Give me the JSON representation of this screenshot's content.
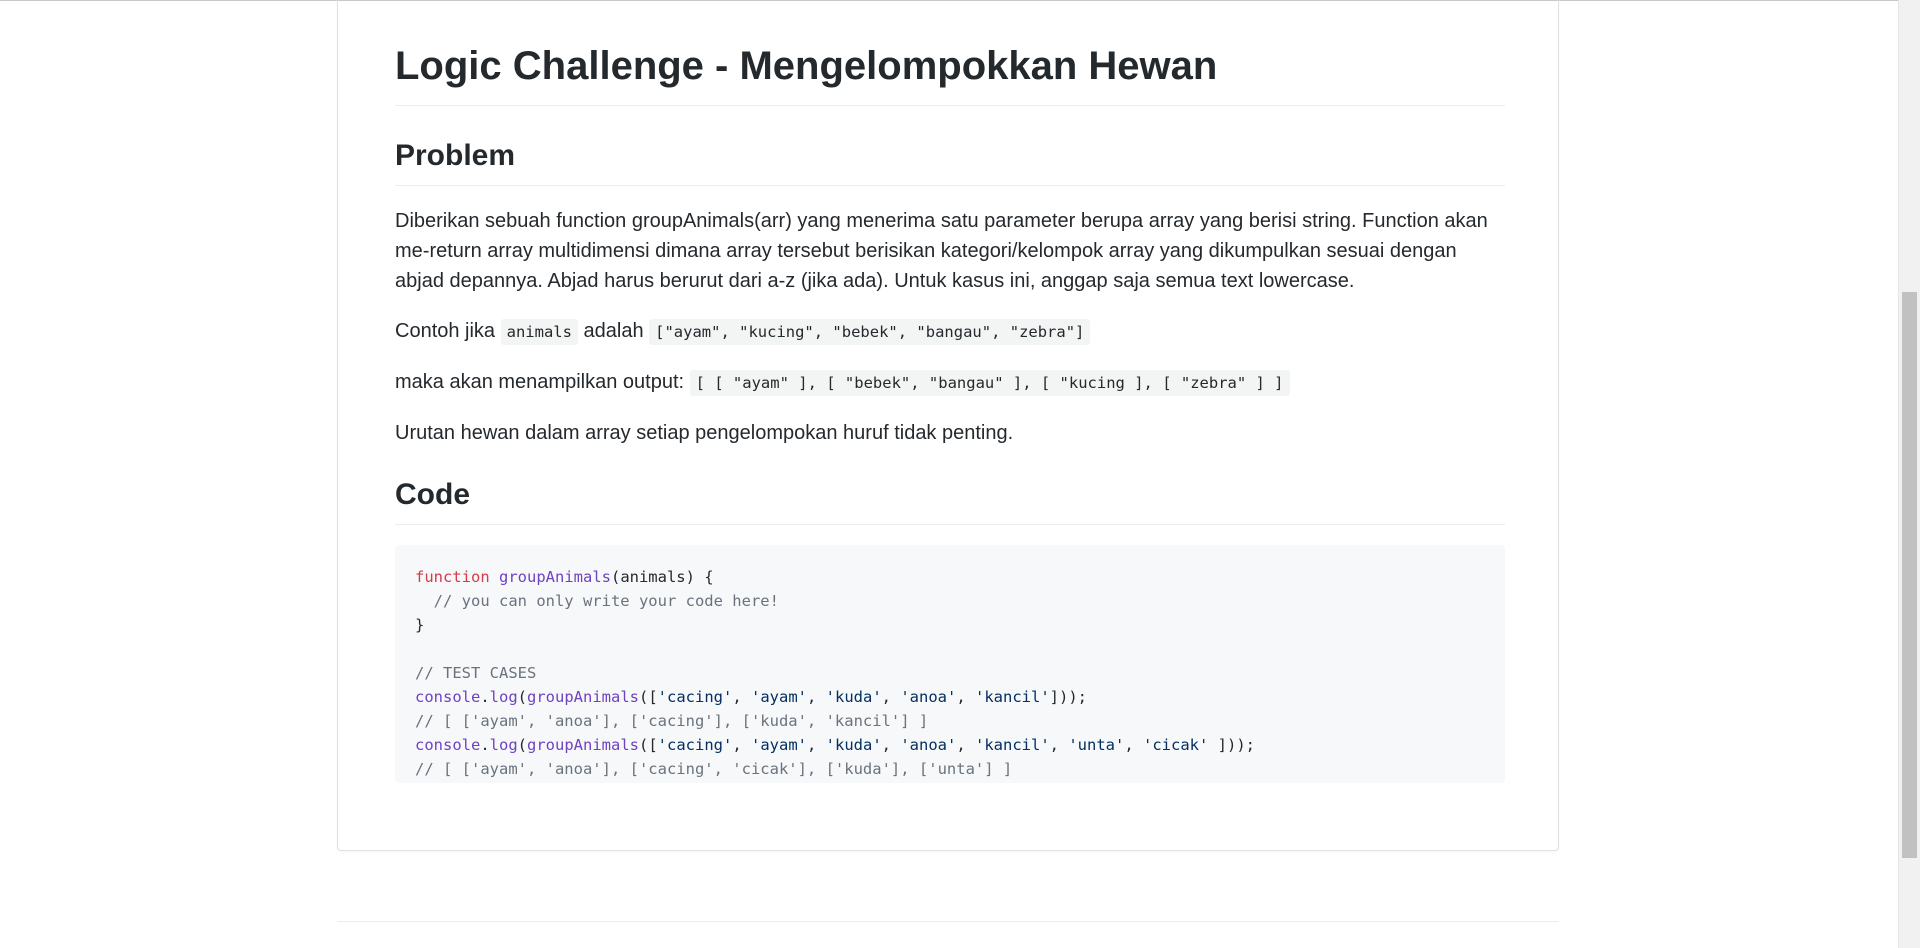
{
  "page": {
    "title": "Logic Challenge - Mengelompokkan Hewan",
    "problem_heading": "Problem",
    "description": "Diberikan sebuah function groupAnimals(arr) yang menerima satu parameter berupa array yang berisi string. Function akan me-return array multidimensi dimana array tersebut berisikan kategori/kelompok array yang dikumpulkan sesuai dengan abjad depannya. Abjad harus berurut dari a-z (jika ada). Untuk kasus ini, anggap saja semua text lowercase.",
    "example_prefix": "Contoh jika ",
    "example_var": "animals",
    "example_mid": " adalah ",
    "example_array": "[\"ayam\", \"kucing\", \"bebek\", \"bangau\", \"zebra\"]",
    "output_prefix": "maka akan menampilkan output: ",
    "output_code": "[ [ \"ayam\" ], [ \"bebek\", \"bangau\" ], [ \"kucing ], [ \"zebra\" ] ]",
    "note": "Urutan hewan dalam array setiap pengelompokan huruf tidak penting.",
    "code_heading": "Code"
  },
  "code": {
    "l1_kw": "function",
    "l1_fn": "groupAnimals",
    "l1_rest": "(animals) {",
    "l2": "  // you can only write your code here!",
    "l3": "}",
    "l5": "// TEST CASES",
    "l6_obj": "console",
    "l6_dot": ".",
    "l6_method": "log",
    "l6_open": "(",
    "l6_fn": "groupAnimals",
    "l6_args_open": "([",
    "l6_s1": "'cacing'",
    "l6_s2": "'ayam'",
    "l6_s3": "'kuda'",
    "l6_s4": "'anoa'",
    "l6_s5": "'kancil'",
    "l6_close": "]));",
    "l7": "// [ ['ayam', 'anoa'], ['cacing'], ['kuda', 'kancil'] ]",
    "l8_s6": "'unta'",
    "l8_s7": "'cicak'",
    "l8_close": " ]));",
    "l9": "// [ ['ayam', 'anoa'], ['cacing', 'cicak'], ['kuda'], ['unta'] ]",
    "sep": ", "
  },
  "colors": {
    "keyword": "#d73a49",
    "function": "#6f42c1",
    "comment": "#6a737d",
    "string": "#032f62",
    "code_bg": "#f6f8fa"
  }
}
